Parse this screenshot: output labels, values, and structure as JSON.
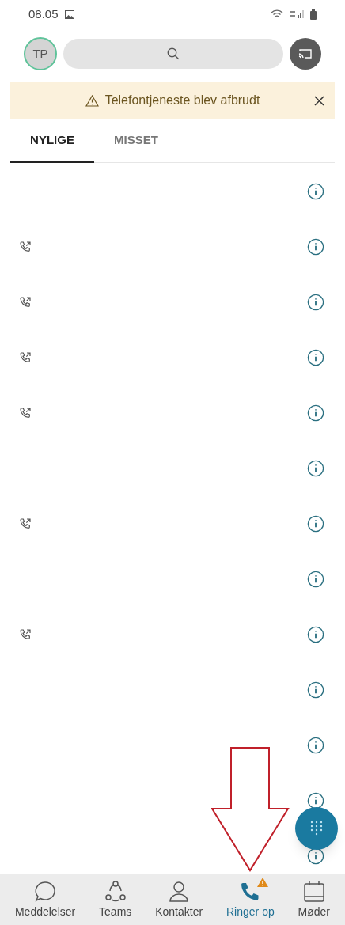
{
  "status_bar": {
    "time": "08.05"
  },
  "header": {
    "avatar": "TP"
  },
  "banner": {
    "text": "Telefontjeneste blev afbrudt"
  },
  "tabs": [
    {
      "label": "NYLIGE",
      "selected": true
    },
    {
      "label": "MISSET",
      "selected": false
    }
  ],
  "calls": [
    {
      "kind": "blank"
    },
    {
      "kind": "outgoing"
    },
    {
      "kind": "outgoing"
    },
    {
      "kind": "outgoing"
    },
    {
      "kind": "outgoing"
    },
    {
      "kind": "blank"
    },
    {
      "kind": "outgoing"
    },
    {
      "kind": "blank"
    },
    {
      "kind": "outgoing"
    },
    {
      "kind": "blank"
    },
    {
      "kind": "blank"
    },
    {
      "kind": "blank"
    },
    {
      "kind": "blank"
    }
  ],
  "nav": [
    {
      "kind": "chat",
      "label": "Meddelelser",
      "selected": false,
      "alert": false
    },
    {
      "kind": "teams",
      "label": "Teams",
      "selected": false,
      "alert": false
    },
    {
      "kind": "contact",
      "label": "Kontakter",
      "selected": false,
      "alert": false
    },
    {
      "kind": "phone",
      "label": "Ringer op",
      "selected": true,
      "alert": true
    },
    {
      "kind": "calendar",
      "label": "Møder",
      "selected": false,
      "alert": false
    }
  ]
}
